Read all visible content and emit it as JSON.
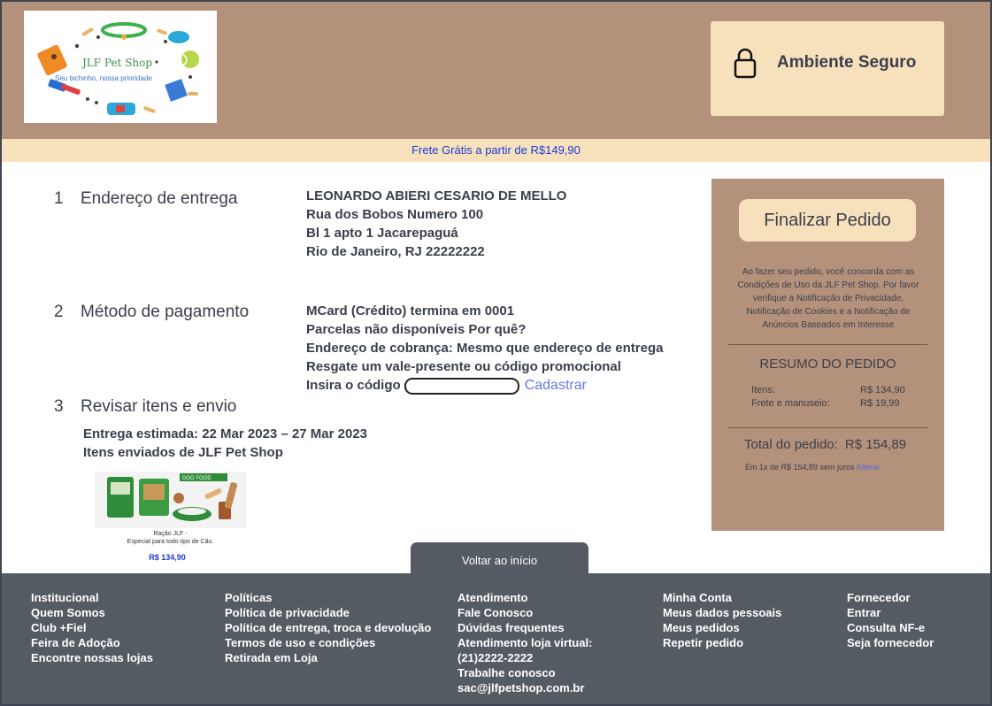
{
  "header": {
    "logo_title": "JLF Pet Shop",
    "logo_tagline": "Seu bichinho, nossa prioridade",
    "secure_label": "Ambiente Seguro",
    "shipping_banner": "Frete Grátis a partir de R$149,90"
  },
  "sections": [
    {
      "number": "1",
      "title": "Endereço de entrega",
      "lines": [
        "LEONARDO ABIERI CESARIO DE MELLO",
        "Rua dos Bobos Numero 100",
        "Bl 1 apto 1 Jacarepaguá",
        "Rio de Janeiro, RJ 22222222"
      ]
    },
    {
      "number": "2",
      "title": "Método de pagamento",
      "lines": [
        "MCard (Crédito) termina em  0001",
        "Parcelas não disponíveis Por quê?",
        "Endereço de cobrança: Mesmo que endereço de entrega",
        "Resgate um vale-presente ou código promocional"
      ],
      "code_label": "Insira o código",
      "code_value": "",
      "register_link": "Cadastrar"
    },
    {
      "number": "3",
      "title": "Revisar itens e envio",
      "lines": [
        "Entrega estimada: 22 Mar 2023 – 27 Mar 2023",
        "Itens enviados de JLF Pet Shop"
      ]
    }
  ],
  "product": {
    "badge": "DOG FOOD",
    "caption_line1": "Ração JLF -",
    "caption_line2": "Especial para todo tipo de Cão.",
    "price": "R$ 134,90"
  },
  "summary": {
    "finalize_button": "Finalizar Pedido",
    "terms": "Ao fazer seu pedido, você concorda com as Condições de Uso da JLF Pet Shop. Por favor verifique a Notificação de Privacidade, Notificação de Cookies e a Notificação de Anúncios Baseados em Interesse",
    "title": "RESUMO DO PEDIDO",
    "items_label": "Itens:",
    "items_value": "R$ 134,90",
    "shipping_label": "Frete e manuseio:",
    "shipping_value": "R$ 19,99",
    "total_label": "Total do pedido:",
    "total_value": "R$ 154,89",
    "installment_text": "Em 1x de R$ 154,89 sem juros",
    "change_link": "Alterar"
  },
  "footer": {
    "back_label": "Voltar ao início",
    "columns": [
      [
        "Institucional",
        "Quem Somos",
        "Club +Fiel",
        "Feira de Adoção",
        "Encontre nossas lojas"
      ],
      [
        "Políticas",
        "Política de privacidade",
        "Política de entrega, troca e devolução",
        "Termos de uso e condições",
        "Retirada em Loja"
      ],
      [
        "Atendimento",
        "Fale Conosco",
        "Dúvidas frequentes",
        "Atendimento loja virtual:",
        "(21)2222-2222",
        "Trabalhe conosco",
        "sac@jlfpetshop.com.br"
      ],
      [
        "Minha Conta",
        "Meus dados pessoais",
        "Meus pedidos",
        "Repetir pedido"
      ],
      [
        "Fornecedor",
        "Entrar",
        "Consulta NF-e",
        "Seja fornecedor"
      ]
    ]
  },
  "colors": {
    "header_bg": "#b4917a",
    "cream": "#f6e1bc",
    "footer_bg": "#555b63",
    "link_blue": "#1f3ad6"
  }
}
